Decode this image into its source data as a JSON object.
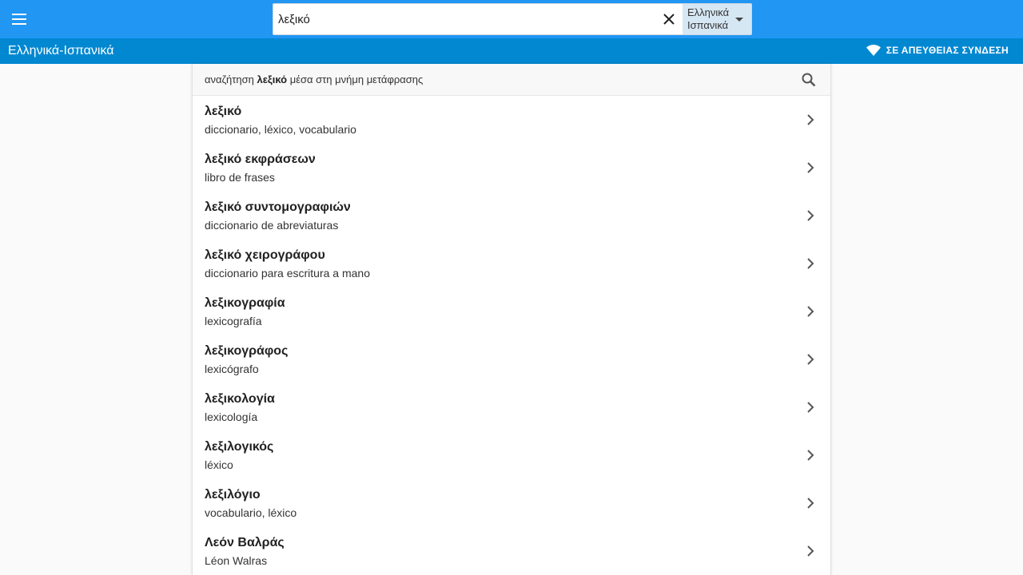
{
  "topbar": {
    "menu_icon": "hamburger-menu-icon",
    "search": {
      "value": "λεξικό",
      "clear_icon": "close-icon"
    },
    "language_select": {
      "line1": "Ελληνικά",
      "line2": "Ισπανικά",
      "caret_icon": "caret-down-icon"
    }
  },
  "subbar": {
    "title": "Ελληνικά-Ισπανικά",
    "status_label": "ΣΕ ΑΠΕΥΘΕΙΑΣ ΣΥΝΔΕΣΗ",
    "status_icon": "wifi-icon"
  },
  "memory_search": {
    "prefix": "αναζήτηση",
    "term": "λεξικό",
    "suffix": "μέσα στη μνήμη μετάφρασης",
    "icon": "search-icon"
  },
  "results": [
    {
      "head": "λεξικό",
      "trans": "diccionario, léxico, vocabulario"
    },
    {
      "head": "λεξικό εκφράσεων",
      "trans": "libro de frases"
    },
    {
      "head": "λεξικό συντομογραφιών",
      "trans": "diccionario de abreviaturas"
    },
    {
      "head": "λεξικό χειρογράφου",
      "trans": "diccionario para escritura a mano"
    },
    {
      "head": "λεξικογραφία",
      "trans": "lexicografía"
    },
    {
      "head": "λεξικογράφος",
      "trans": "lexicógrafo"
    },
    {
      "head": "λεξικολογία",
      "trans": "lexicología"
    },
    {
      "head": "λεξιλογικός",
      "trans": "léxico"
    },
    {
      "head": "λεξιλόγιο",
      "trans": "vocabulario, léxico"
    },
    {
      "head": "Λεόν Βαλράς",
      "trans": "Léon Walras"
    }
  ],
  "colors": {
    "topbar": "#2196f3",
    "subbar": "#0288d1",
    "language_select_bg": "#d6e7f4"
  }
}
